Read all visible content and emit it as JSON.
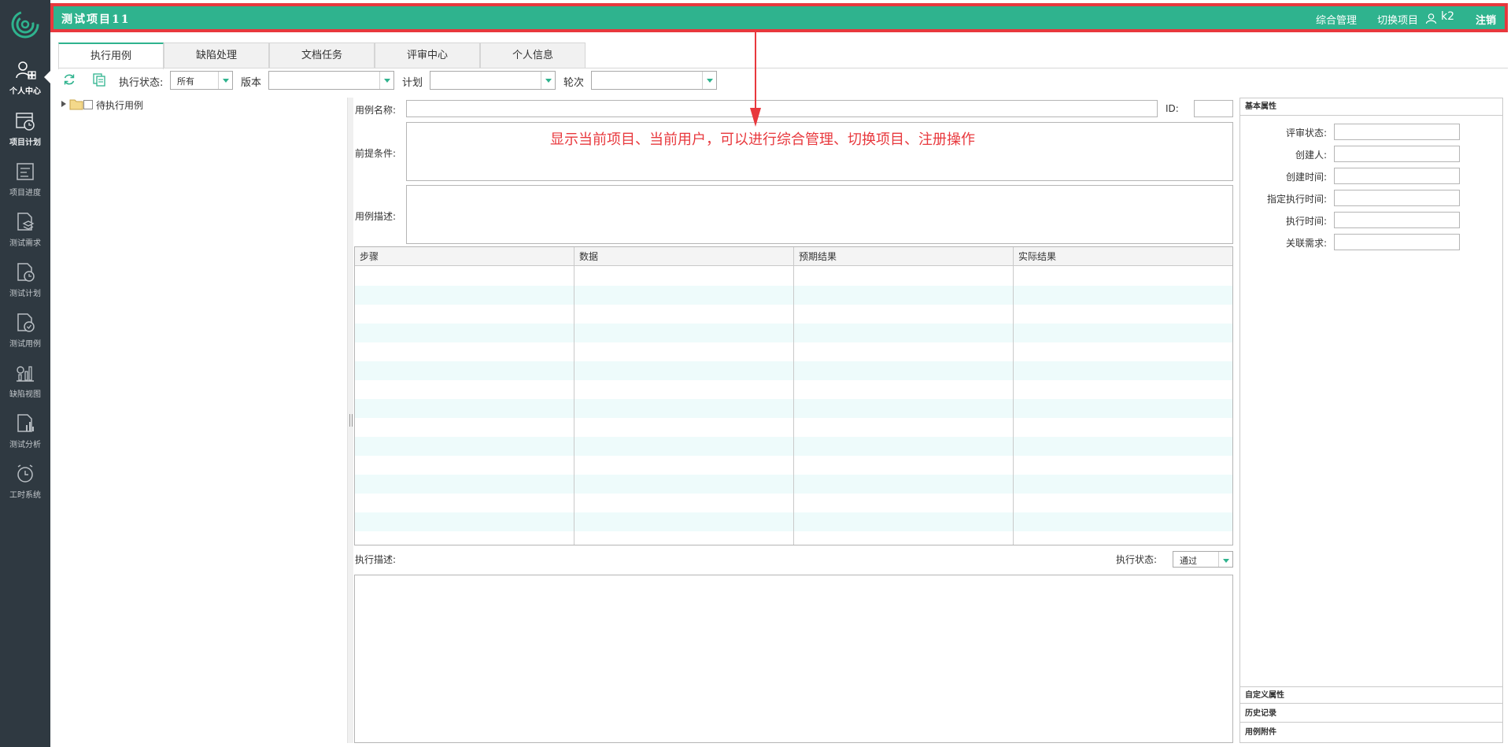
{
  "header": {
    "project_title": "测试项目11",
    "manage_label": "综合管理",
    "switch_label": "切换项目",
    "username": "k2",
    "logout_label": "注销"
  },
  "sidebar": {
    "items": [
      {
        "label": "个人中心"
      },
      {
        "label": "项目计划"
      },
      {
        "label": "项目进度"
      },
      {
        "label": "测试需求"
      },
      {
        "label": "测试计划"
      },
      {
        "label": "测试用例"
      },
      {
        "label": "缺陷视图"
      },
      {
        "label": "测试分析"
      },
      {
        "label": "工时系统"
      }
    ]
  },
  "tabs": [
    {
      "label": "执行用例"
    },
    {
      "label": "缺陷处理"
    },
    {
      "label": "文档任务"
    },
    {
      "label": "评审中心"
    },
    {
      "label": "个人信息"
    }
  ],
  "toolbar": {
    "status_label": "执行状态:",
    "status_value": "所有",
    "version_label": "版本",
    "version_value": "",
    "plan_label": "计划",
    "plan_value": "",
    "round_label": "轮次",
    "round_value": ""
  },
  "tree": {
    "root_label": "待执行用例"
  },
  "form": {
    "name_label": "用例名称:",
    "name_value": "",
    "id_label": "ID:",
    "id_value": "",
    "precondition_label": "前提条件:",
    "description_label": "用例描述:",
    "steps_columns": [
      "步骤",
      "数据",
      "预期结果",
      "实际结果"
    ],
    "exec_desc_label": "执行描述:",
    "exec_status_label": "执行状态:",
    "exec_status_value": "通过"
  },
  "annotation": {
    "text": "显示当前项目、当前用户，可以进行综合管理、切换项目、注册操作"
  },
  "right_panel": {
    "basic_title": "基本属性",
    "fields": [
      {
        "label": "评审状态:"
      },
      {
        "label": "创建人:"
      },
      {
        "label": "创建时间:"
      },
      {
        "label": "指定执行时间:"
      },
      {
        "label": "执行时间:"
      },
      {
        "label": "关联需求:"
      }
    ],
    "custom_title": "自定义属性",
    "history_title": "历史记录",
    "attachment_title": "用例附件"
  },
  "colors": {
    "accent": "#2fb38e",
    "sidebar_bg": "#2f3941",
    "highlight": "#e8383d",
    "row_alt": "#eefbfb"
  }
}
